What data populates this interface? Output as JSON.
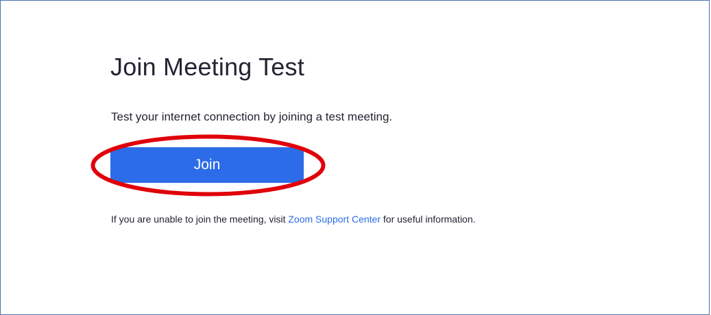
{
  "main": {
    "title": "Join Meeting Test",
    "description": "Test your internet connection by joining a test meeting.",
    "join_button_label": "Join",
    "help_prefix": "If you are unable to join the meeting, visit ",
    "help_link": "Zoom Support Center",
    "help_suffix": " for useful information."
  },
  "colors": {
    "accent": "#2d6ce8",
    "highlight": "#e0000a",
    "text": "#232333",
    "frame_border": "#4a72b0"
  }
}
